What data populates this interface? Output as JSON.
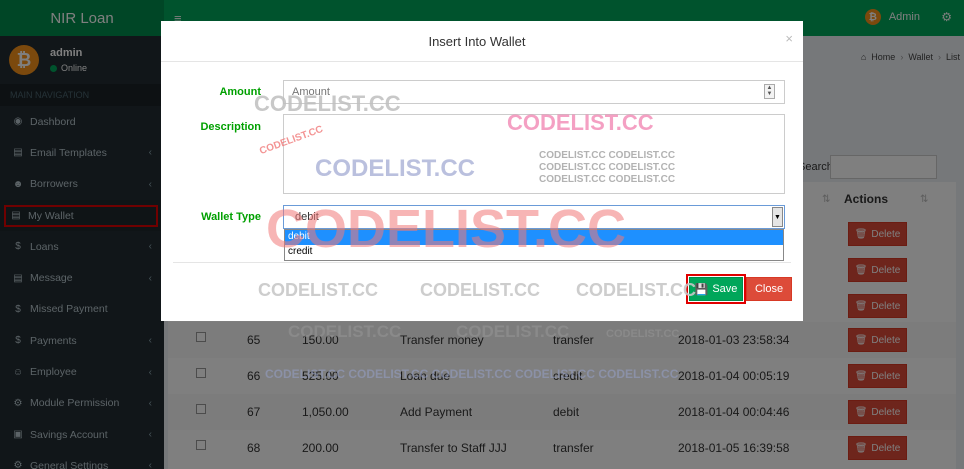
{
  "app": {
    "title": "NIR Loan"
  },
  "sidebar": {
    "user_name": "admin",
    "user_status": "Online",
    "nav_header": "MAIN NAVIGATION",
    "items": [
      {
        "label": "Dashbord",
        "icon": "dashboard-icon",
        "glyph": "◉",
        "chevron": ""
      },
      {
        "label": "Email Templates",
        "icon": "book-icon",
        "glyph": "▤",
        "chevron": "‹"
      },
      {
        "label": "Borrowers",
        "icon": "users-icon",
        "glyph": "☻",
        "chevron": "‹"
      },
      {
        "label": "My Wallet",
        "icon": "book-icon",
        "glyph": "▤",
        "chevron": ""
      },
      {
        "label": "Loans",
        "icon": "dollar-icon",
        "glyph": "$",
        "chevron": "‹"
      },
      {
        "label": "Message",
        "icon": "book-icon",
        "glyph": "▤",
        "chevron": "‹"
      },
      {
        "label": "Missed Payment",
        "icon": "dollar-icon",
        "glyph": "$",
        "chevron": ""
      },
      {
        "label": "Payments",
        "icon": "dollar-icon",
        "glyph": "$",
        "chevron": "‹"
      },
      {
        "label": "Employee",
        "icon": "user-icon",
        "glyph": "☺",
        "chevron": "‹"
      },
      {
        "label": "Module Permission",
        "icon": "cogs-icon",
        "glyph": "⚙",
        "chevron": "‹"
      },
      {
        "label": "Savings Account",
        "icon": "money-icon",
        "glyph": "▣",
        "chevron": "‹"
      },
      {
        "label": "General Settings",
        "icon": "gear-icon",
        "glyph": "⚙",
        "chevron": "‹"
      }
    ]
  },
  "topbar": {
    "user_name": "Admin"
  },
  "breadcrumb": {
    "home": "Home",
    "wallet": "Wallet",
    "list": "List"
  },
  "search": {
    "label": "Search:"
  },
  "table": {
    "actions_header": "Actions",
    "delete_label": "Delete",
    "rows": [
      {
        "id": "65",
        "amount": "150.00",
        "description": "Transfer money",
        "type": "transfer",
        "date": "2018-01-03 23:58:34"
      },
      {
        "id": "66",
        "amount": "525.00",
        "description": "Loan due",
        "type": "credit",
        "date": "2018-01-04 00:05:19"
      },
      {
        "id": "67",
        "amount": "1,050.00",
        "description": "Add Payment",
        "type": "debit",
        "date": "2018-01-04 00:04:46"
      },
      {
        "id": "68",
        "amount": "200.00",
        "description": "Transfer to Staff JJJ",
        "type": "transfer",
        "date": "2018-01-05 16:39:58"
      }
    ]
  },
  "modal": {
    "title": "Insert Into Wallet",
    "close_glyph": "×",
    "amount_label": "Amount",
    "amount_placeholder": "Amount",
    "description_label": "Description",
    "wallet_type_label": "Wallet Type",
    "wallet_type_value": "debit",
    "wallet_type_options": [
      "debit",
      "credit"
    ],
    "save_label": "Save",
    "close_label": "Close"
  },
  "watermark": {
    "text": "CODELIST.CC",
    "row_text": "CODELIST.CC CODELIST.CC",
    "strip_text": "CODELIST.CC  CODELIST.CC  CODELIST.CC  CODELIST.CC  CODELIST.CC"
  },
  "colors": {
    "topbar": "#00a65a",
    "sidebar": "#222d32",
    "save": "#00a65a",
    "danger": "#dd4b39",
    "label_green": "#00a000",
    "highlight_red": "#e00000"
  }
}
